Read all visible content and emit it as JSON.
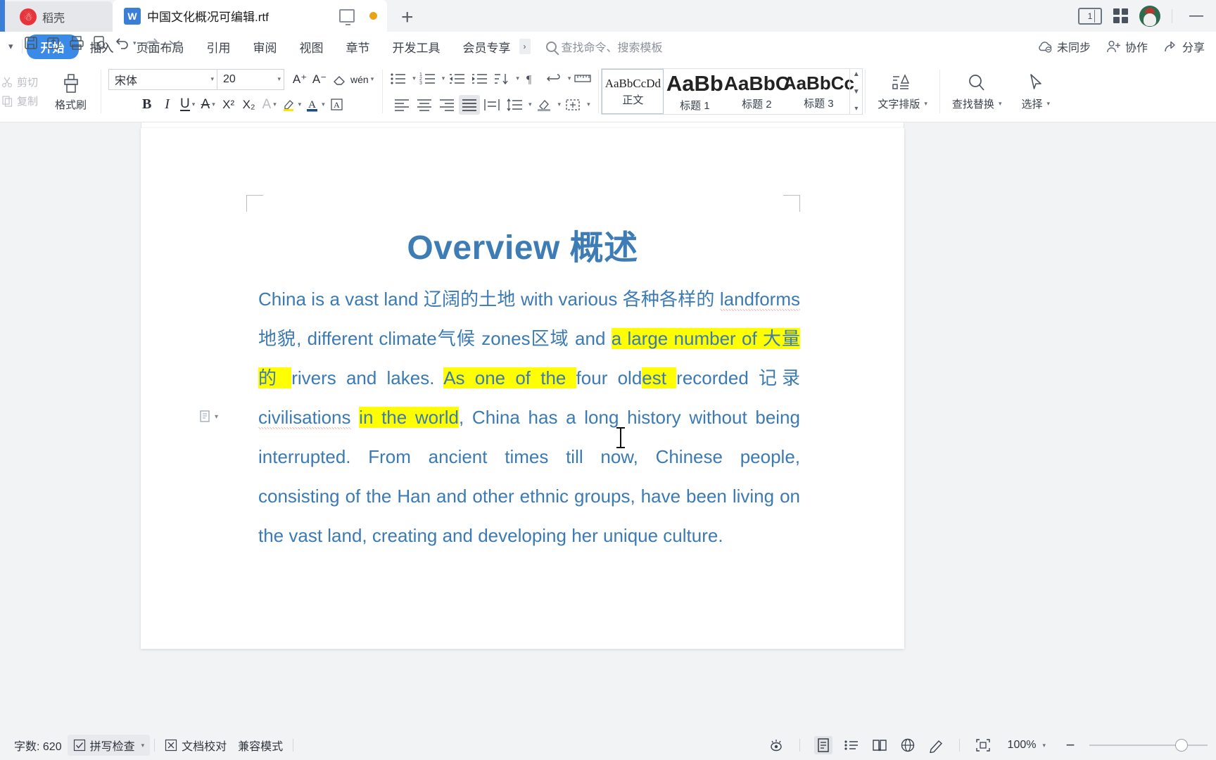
{
  "window": {
    "daoke_label": "稻壳",
    "document_tab": "中国文化概况可编辑.rtf",
    "new_tab_label": "+",
    "page_count_badge": "1",
    "minimize_label": "—"
  },
  "ribbon": {
    "collapse_icon": "chevron-down-icon",
    "tabs": [
      {
        "label": "开始",
        "active": true
      },
      {
        "label": "插入",
        "active": false
      },
      {
        "label": "页面布局",
        "active": false
      },
      {
        "label": "引用",
        "active": false
      },
      {
        "label": "审阅",
        "active": false
      },
      {
        "label": "视图",
        "active": false
      },
      {
        "label": "章节",
        "active": false
      },
      {
        "label": "开发工具",
        "active": false
      },
      {
        "label": "会员专享",
        "active": false
      }
    ],
    "vip_chevron": "›",
    "search_placeholder": "查找命令、搜索模板",
    "right_items": [
      {
        "label": "未同步",
        "icon": "cloud-off-icon"
      },
      {
        "label": "协作",
        "icon": "user-add-icon"
      },
      {
        "label": "分享",
        "icon": "share-icon"
      }
    ]
  },
  "toolbar": {
    "cut_label": "剪切",
    "copy_label": "复制",
    "format_painter_label": "格式刷",
    "font_name": "宋体",
    "font_size": "20",
    "grow_font": "A⁺",
    "shrink_font": "A⁻",
    "clear_format": "clear-format-icon",
    "pinyin_guide": "wén",
    "bold": "B",
    "italic": "I",
    "underline": "U",
    "strikethrough": "A",
    "superscript": "X²",
    "subscript": "X₂",
    "text_effect": "A",
    "highlight": "highlight-icon",
    "font_color": "font-color-icon",
    "char_border": "A",
    "styles": [
      {
        "preview": "AaBbCcDd",
        "label": "正文",
        "selected": true,
        "size": "17px",
        "weight": "normal"
      },
      {
        "preview": "AaBb",
        "label": "标题 1",
        "selected": false,
        "size": "30px",
        "weight": "bold"
      },
      {
        "preview": "AaBbC",
        "label": "标题 2",
        "selected": false,
        "size": "27px",
        "weight": "bold"
      },
      {
        "preview": "AaBbCc",
        "label": "标题 3",
        "selected": false,
        "size": "25px",
        "weight": "bold"
      }
    ],
    "text_layout_label": "文字排版",
    "find_replace_label": "查找替换",
    "select_label": "选择"
  },
  "document": {
    "title": "Overview 概述",
    "title_color": "#3d7cb5",
    "body_color": "#3b7ab3",
    "highlight_color": "#ffff00",
    "paragraph_runs": [
      {
        "text": "China is a vast land 辽阔的土地  with various 各种各样的 ",
        "highlight": false,
        "spell_error": false
      },
      {
        "text": "landforms",
        "highlight": false,
        "spell_error": true
      },
      {
        "text": "地貌, different climate气候  zones区域  and ",
        "highlight": false,
        "spell_error": false
      },
      {
        "text": "a large number of 大量的 ",
        "highlight": true,
        "spell_error": false
      },
      {
        "text": "rivers and lakes. ",
        "highlight": false,
        "spell_error": false
      },
      {
        "text": "As one of the ",
        "highlight": true,
        "spell_error": false
      },
      {
        "text": "four old",
        "highlight": false,
        "spell_error": false
      },
      {
        "text": "est ",
        "highlight": true,
        "spell_error": false
      },
      {
        "text": "recorded 记录 ",
        "highlight": false,
        "spell_error": false
      },
      {
        "text": "civilisations",
        "highlight": false,
        "spell_error": true
      },
      {
        "text": " ",
        "highlight": false,
        "spell_error": false
      },
      {
        "text": "in the world",
        "highlight": true,
        "spell_error": false
      },
      {
        "text": ", China has a long history without being interrupted. From ancient times till now, Chinese people, consisting of the Han and other ethnic groups, have been living on the vast land, creating and developing her unique culture.",
        "highlight": false,
        "spell_error": false
      }
    ]
  },
  "status": {
    "word_count": "字数: 620",
    "spell_check": "拼写检查",
    "doc_proof": "文档校对",
    "compat_mode": "兼容模式",
    "zoom_level": "100%",
    "view_icons": [
      "eye-icon",
      "page-view-icon",
      "outline-view-icon",
      "read-view-icon",
      "web-view-icon",
      "edit-pen-icon",
      "fit-page-icon"
    ],
    "zoom_out": "−",
    "zoom_in": "+"
  }
}
